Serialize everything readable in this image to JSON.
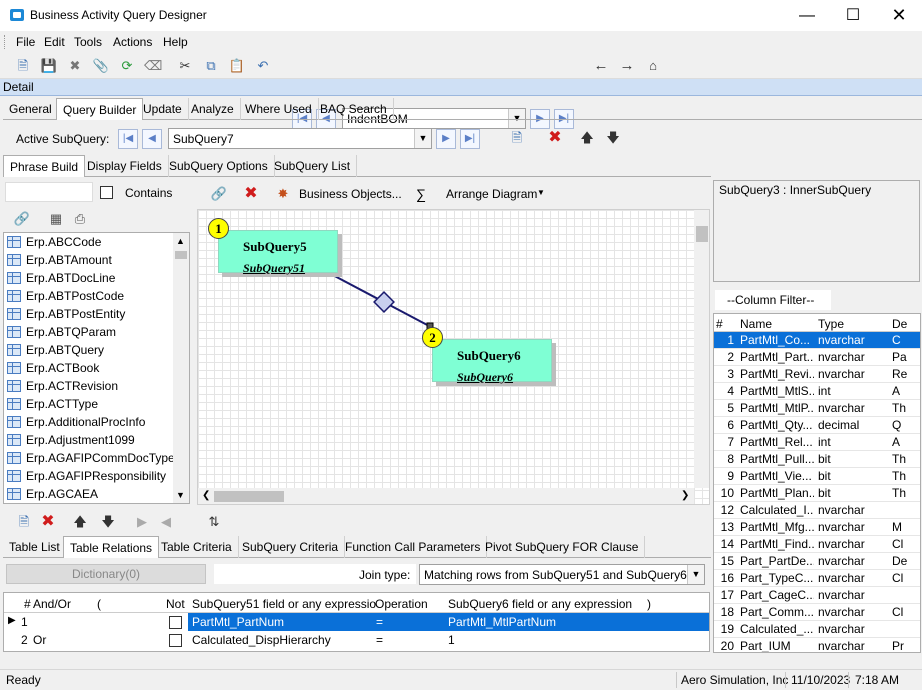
{
  "window": {
    "title": "Business Activity Query Designer"
  },
  "menu": [
    "File",
    "Edit",
    "Tools",
    "Actions",
    "Help"
  ],
  "toolbar": {
    "query_id": "IndentBOM"
  },
  "section": {
    "title": "Detail"
  },
  "main_tabs": [
    "General",
    "Query Builder",
    "Update",
    "Analyze",
    "Where Used",
    "BAQ Search"
  ],
  "active_subquery": {
    "label": "Active SubQuery:",
    "value": "SubQuery7"
  },
  "sub_tabs": [
    "Phrase Build",
    "Display Fields",
    "SubQuery Options",
    "SubQuery List"
  ],
  "left_panel": {
    "contains_label": "Contains",
    "tables": [
      "Erp.ABCCode",
      "Erp.ABTAmount",
      "Erp.ABTDocLine",
      "Erp.ABTPostCode",
      "Erp.ABTPostEntity",
      "Erp.ABTQParam",
      "Erp.ABTQuery",
      "Erp.ACTBook",
      "Erp.ACTRevision",
      "Erp.ACTType",
      "Erp.AdditionalProcInfo",
      "Erp.Adjustment1099",
      "Erp.AGAFIPCommDocType",
      "Erp.AGAFIPResponsibility",
      "Erp.AGCAEA"
    ]
  },
  "diagram_toolbar": {
    "business_objects": "Business Objects...",
    "sigma": "∑",
    "arrange": "Arrange Diagram"
  },
  "diagram": {
    "nodes": [
      {
        "badge": "1",
        "title": "SubQuery5",
        "subtitle": "SubQuery51"
      },
      {
        "badge": "2",
        "title": "SubQuery6",
        "subtitle": "SubQuery6"
      }
    ]
  },
  "right_panel": {
    "header": "SubQuery3 : InnerSubQuery",
    "filter": "--Column Filter--",
    "columns": [
      "#",
      "Name",
      "Type",
      "De"
    ],
    "rows": [
      [
        "1",
        "PartMtl_Co...",
        "nvarchar",
        "C"
      ],
      [
        "2",
        "PartMtl_Part...",
        "nvarchar",
        "Pa"
      ],
      [
        "3",
        "PartMtl_Revi...",
        "nvarchar",
        "Re"
      ],
      [
        "4",
        "PartMtl_MtlS...",
        "int",
        "A"
      ],
      [
        "5",
        "PartMtl_MtlP...",
        "nvarchar",
        "Th"
      ],
      [
        "6",
        "PartMtl_Qty...",
        "decimal",
        "Q"
      ],
      [
        "7",
        "PartMtl_Rel...",
        "int",
        "A"
      ],
      [
        "8",
        "PartMtl_Pull...",
        "bit",
        "Th"
      ],
      [
        "9",
        "PartMtl_Vie...",
        "bit",
        "Th"
      ],
      [
        "10",
        "PartMtl_Plan...",
        "bit",
        "Th"
      ],
      [
        "12",
        "Calculated_I...",
        "nvarchar",
        ""
      ],
      [
        "13",
        "PartMtl_Mfg...",
        "nvarchar",
        "M"
      ],
      [
        "14",
        "PartMtl_Find...",
        "nvarchar",
        "Cl"
      ],
      [
        "15",
        "Part_PartDe...",
        "nvarchar",
        "De"
      ],
      [
        "16",
        "Part_TypeC...",
        "nvarchar",
        "Cl"
      ],
      [
        "17",
        "Part_CageC...",
        "nvarchar",
        ""
      ],
      [
        "18",
        "Part_Comm...",
        "nvarchar",
        "Cl"
      ],
      [
        "19",
        "Calculated_...",
        "nvarchar",
        ""
      ],
      [
        "20",
        "Part_IUM",
        "nvarchar",
        "Pr"
      ]
    ]
  },
  "bottom_tabs": [
    "Table List",
    "Table Relations",
    "Table Criteria",
    "SubQuery Criteria",
    "Function Call Parameters",
    "Pivot SubQuery FOR Clause"
  ],
  "relations": {
    "dictionary_btn": "Dictionary(0)",
    "join_type_label": "Join type:",
    "join_type_value": "Matching rows from SubQuery51 and SubQuery6",
    "headers": [
      "#",
      "And/Or",
      "(",
      "Not",
      "SubQuery51 field or any expressio",
      "Operation",
      "SubQuery6 field or any expression",
      ")"
    ],
    "rows": [
      {
        "num": "1",
        "andor": "",
        "field1": "PartMtl_PartNum",
        "op": "=",
        "field2": "PartMtl_MtlPartNum"
      },
      {
        "num": "2",
        "andor": "Or",
        "field1": "Calculated_DispHierarchy",
        "op": "=",
        "field2": "1"
      }
    ]
  },
  "status": {
    "text": "Ready",
    "company": "Aero Simulation, Inc",
    "date": "11/10/2023",
    "time": "7:18 AM"
  },
  "colors": {
    "node_fill": "#7fffd4",
    "badge_fill": "#ffff00",
    "selection": "#0a70d8",
    "header_band": "#cfe0f5"
  }
}
